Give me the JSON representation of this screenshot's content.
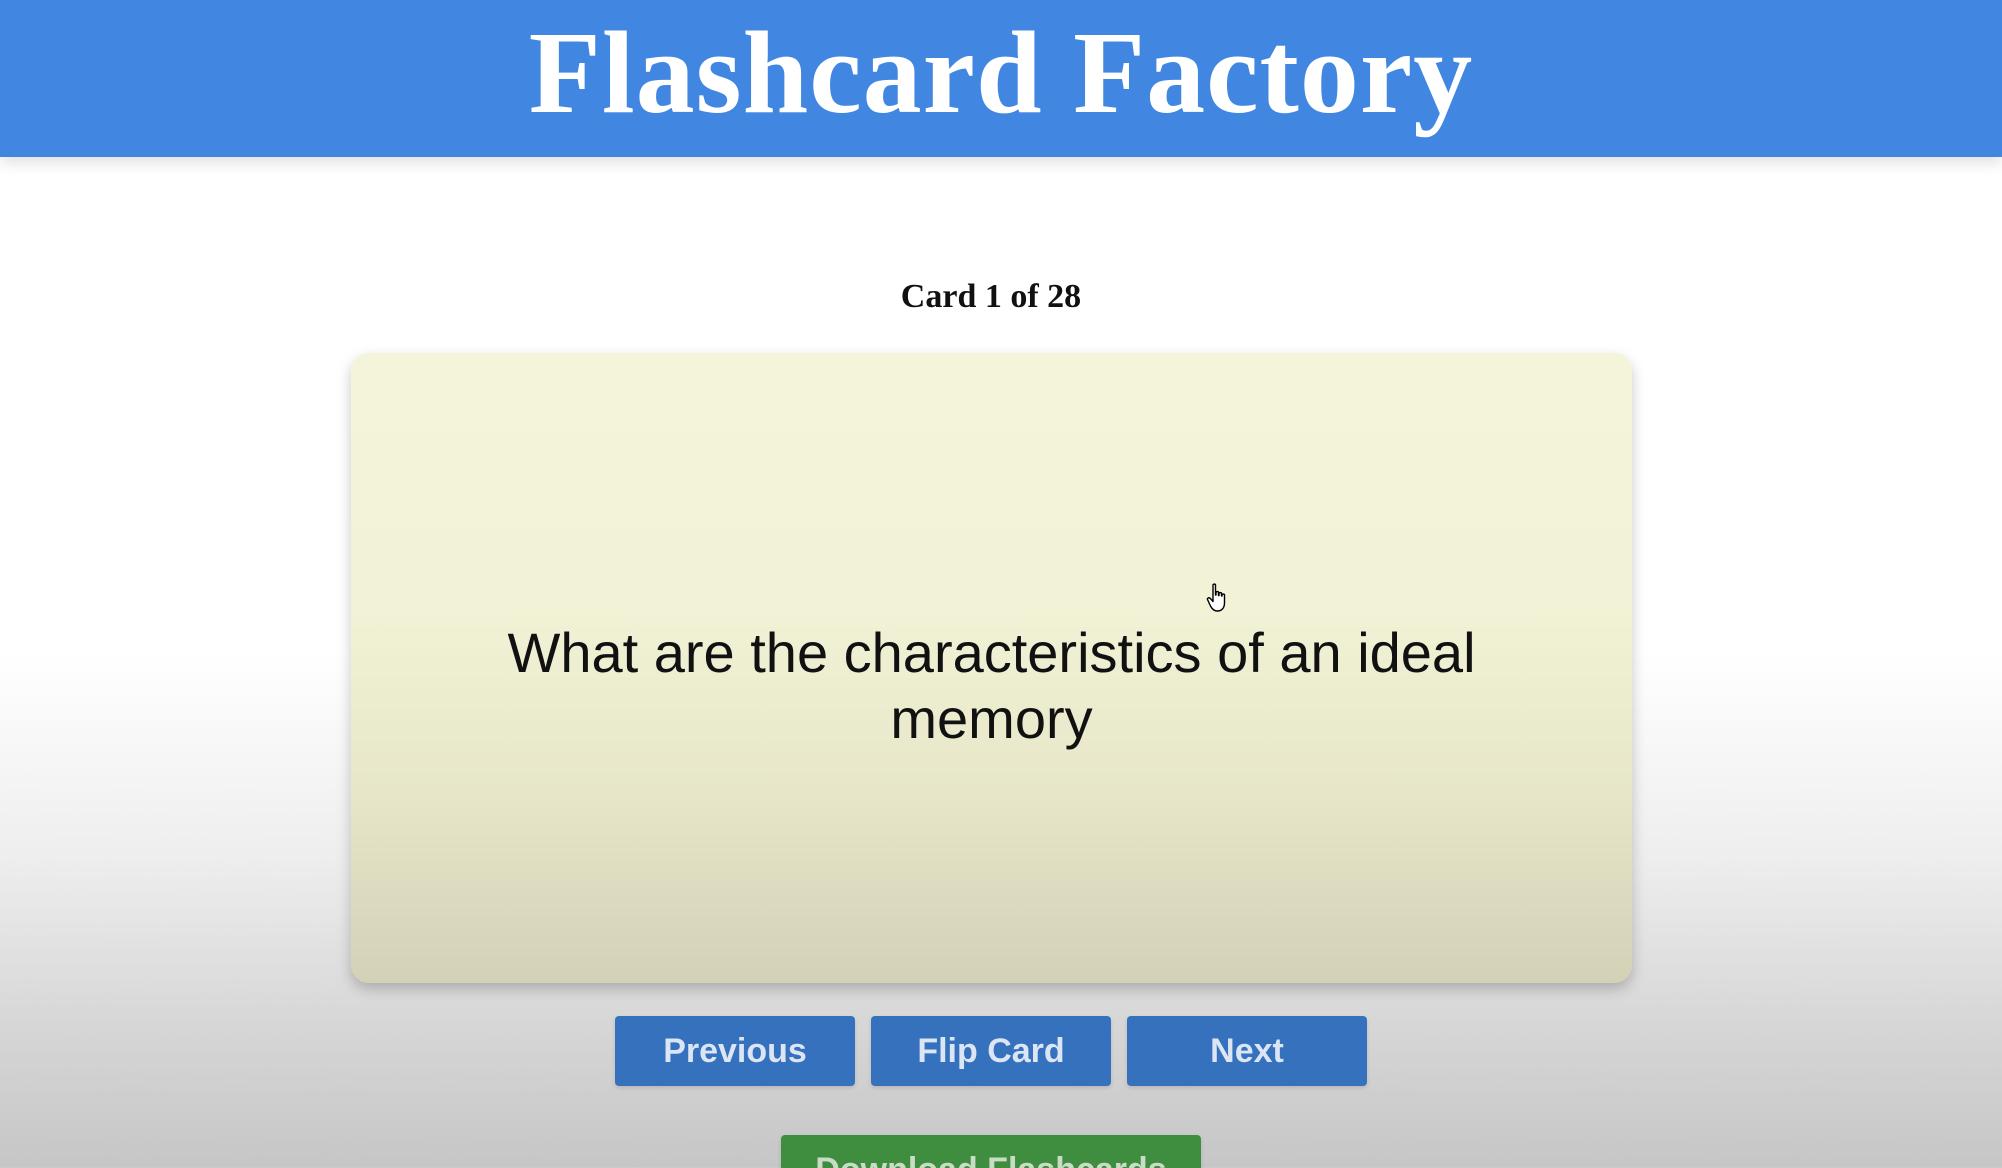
{
  "header": {
    "title": "Flashcard Factory"
  },
  "deck": {
    "counter_text": "Card 1 of 28",
    "current_card": {
      "text": "What are the characteristics of an ideal memory"
    }
  },
  "controls": {
    "previous_label": "Previous",
    "flip_label": "Flip Card",
    "next_label": "Next",
    "download_label": "Download Flashcards"
  },
  "icons": {
    "cursor": "hand-pointer-icon"
  },
  "colors": {
    "header_bg": "#4187e2",
    "card_bg": "#f3f4d9",
    "nav_button_bg": "#3671be",
    "download_button_bg": "#3f8e3f"
  }
}
